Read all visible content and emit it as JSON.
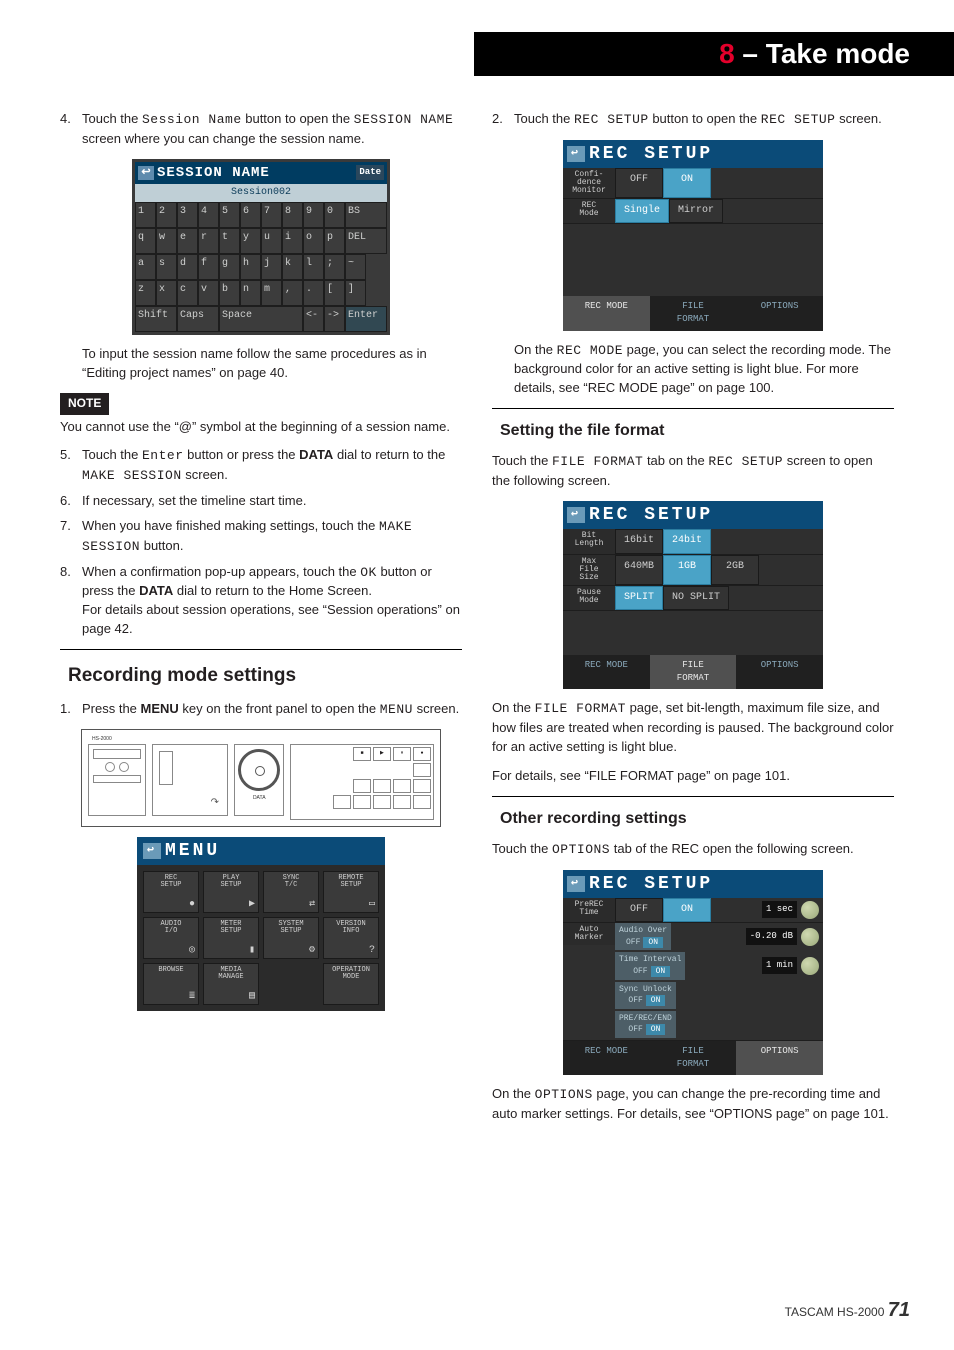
{
  "chapter": {
    "num": "8",
    "sep": " – ",
    "title": "Take mode"
  },
  "left": {
    "step4": {
      "n": "4.",
      "body": [
        "Touch the ",
        "Session Name",
        " button to open the ",
        "SESSION NAME",
        " screen where you can change the session name."
      ]
    },
    "kbd": {
      "title": "SESSION NAME",
      "date": "Date",
      "field": "Session002",
      "rows": [
        [
          "1",
          "2",
          "3",
          "4",
          "5",
          "6",
          "7",
          "8",
          "9",
          "0",
          "BS"
        ],
        [
          "q",
          "w",
          "e",
          "r",
          "t",
          "y",
          "u",
          "i",
          "o",
          "p",
          "DEL"
        ],
        [
          "a",
          "s",
          "d",
          "f",
          "g",
          "h",
          "j",
          "k",
          "l",
          ";",
          "~"
        ],
        [
          "z",
          "x",
          "c",
          "v",
          "b",
          "n",
          "m",
          ",",
          ".",
          "[",
          "]"
        ]
      ],
      "bottom": [
        "Shift",
        "Caps",
        "Space",
        "<-",
        "->",
        "Enter"
      ]
    },
    "afterKbd": "To input the session name follow the same procedures as in “Editing project names” on page 40.",
    "note": {
      "tag": "NOTE",
      "body": "You cannot use the “@” symbol at the beginning of a session name."
    },
    "step5": {
      "n": "5.",
      "body": [
        "Touch the ",
        "Enter",
        " button or press the ",
        "DATA",
        " dial to return to the ",
        "MAKE SESSION",
        " screen."
      ]
    },
    "step6": {
      "n": "6.",
      "body": [
        "If necessary, set the timeline start time."
      ]
    },
    "step7": {
      "n": "7.",
      "body": [
        "When you have finished making settings, touch the ",
        "MAKE SESSION",
        " button."
      ]
    },
    "step8": {
      "n": "8.",
      "body": [
        "When a confirmation pop-up appears, touch the ",
        "OK",
        " button or press the ",
        "DATA",
        " dial to return to the Home Screen."
      ],
      "body2": "For details about session operations, see “Session operations” on page 42."
    },
    "h2": "Recording mode settings",
    "step1b": {
      "n": "1.",
      "body": [
        "Press the ",
        "MENU",
        " key on the front panel to open the ",
        "MENU",
        " screen."
      ]
    },
    "device": "HS-2000",
    "menu": {
      "title": "MENU",
      "items": [
        {
          "t": "REC\nSETUP",
          "i": "●"
        },
        {
          "t": "PLAY\nSETUP",
          "i": "▶"
        },
        {
          "t": "SYNC\nT/C",
          "i": "⇄"
        },
        {
          "t": "REMOTE\nSETUP",
          "i": "▭"
        },
        {
          "t": "AUDIO\nI/O",
          "i": "◎"
        },
        {
          "t": "METER\nSETUP",
          "i": "▮"
        },
        {
          "t": "SYSTEM\nSETUP",
          "i": "⚙"
        },
        {
          "t": "VERSION\nINFO",
          "i": "?"
        },
        {
          "t": "BROWSE",
          "i": "≣"
        },
        {
          "t": "MEDIA\nMANAGE",
          "i": "▤"
        },
        {
          "t": "",
          "i": ""
        },
        {
          "t": "OPERATION\nMODE",
          "i": ""
        }
      ]
    }
  },
  "right": {
    "step2": {
      "n": "2.",
      "body": [
        "Touch the ",
        "REC SETUP",
        " button to open the ",
        "REC SETUP",
        " screen."
      ]
    },
    "rs1": {
      "title": "REC SETUP",
      "rows": [
        {
          "lab": "Confi-\ndence\nMonitor",
          "btns": [
            {
              "t": "OFF"
            },
            {
              "t": "ON",
              "on": true
            }
          ]
        },
        {
          "lab": "REC\nMode",
          "btns": [
            {
              "t": "Single",
              "on": true
            },
            {
              "t": "Mirror"
            }
          ]
        }
      ],
      "tabs": [
        {
          "t": "REC MODE",
          "act": true
        },
        {
          "t": "FILE\nFORMAT"
        },
        {
          "t": "OPTIONS"
        }
      ]
    },
    "afterRs1": [
      "On the ",
      "REC MODE",
      " page, you can select the recording mode. The background color for an active setting is light blue. For more details, see “REC MODE page” on page 100."
    ],
    "h3a": "Setting the file format",
    "h3a_para": [
      "Touch the ",
      "FILE FORMAT",
      " tab on the ",
      "REC SETUP",
      " screen to open the following screen."
    ],
    "rs2": {
      "title": "REC SETUP",
      "rows": [
        {
          "lab": "Bit\nLength",
          "btns": [
            {
              "t": "16bit"
            },
            {
              "t": "24bit",
              "on": true
            }
          ]
        },
        {
          "lab": "Max\nFile\nSize",
          "btns": [
            {
              "t": "640MB"
            },
            {
              "t": "1GB",
              "on": true
            },
            {
              "t": "2GB"
            }
          ]
        },
        {
          "lab": "Pause\nMode",
          "btns": [
            {
              "t": "SPLIT",
              "on": true
            },
            {
              "t": "NO SPLIT"
            }
          ]
        }
      ],
      "tabs": [
        {
          "t": "REC MODE"
        },
        {
          "t": "FILE\nFORMAT",
          "act": true
        },
        {
          "t": "OPTIONS"
        }
      ]
    },
    "afterRs2a": [
      "On the ",
      "FILE FORMAT",
      " page, set bit-length, maximum file size, and how files are treated when recording is paused. The background color for an active setting is light blue."
    ],
    "afterRs2b": "For details, see “FILE FORMAT page” on page 101.",
    "h3b": "Other recording settings",
    "h3b_para": [
      "Touch the ",
      "OPTIONS",
      " tab of the REC open the following screen."
    ],
    "rs3": {
      "title": "REC SETUP",
      "preRec": {
        "lab": "PreREC\nTime",
        "buttons": [
          "OFF",
          "ON"
        ],
        "val": "1 sec"
      },
      "autoMarker": {
        "lab": "Auto\nMarker",
        "rows": [
          {
            "t": "Audio Over",
            "on": "ON",
            "val": "-0.20 dB"
          },
          {
            "t": "Time Interval",
            "on": "ON",
            "val": "1 min"
          },
          {
            "t": "Sync Unlock",
            "on": "ON"
          },
          {
            "t": "PRE/REC/END",
            "on": "ON"
          }
        ]
      },
      "tabs": [
        {
          "t": "REC MODE"
        },
        {
          "t": "FILE\nFORMAT"
        },
        {
          "t": "OPTIONS",
          "act": true
        }
      ]
    },
    "afterRs3": [
      "On the ",
      "OPTIONS",
      " page, you can change the pre-recording time and auto marker settings. For details, see “OPTIONS page” on page 101."
    ]
  },
  "footer": {
    "brand": "TASCAM HS-2000",
    "page": "71"
  }
}
